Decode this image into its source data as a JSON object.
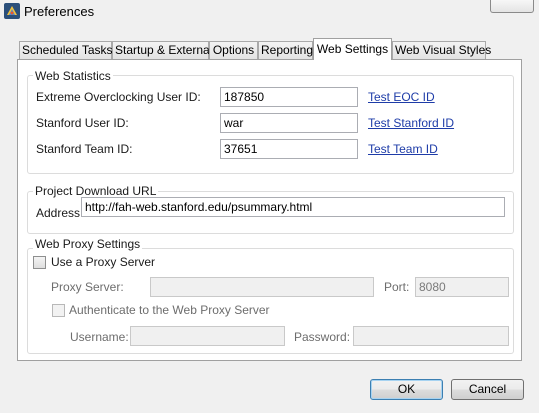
{
  "window": {
    "title": "Preferences"
  },
  "tabs": [
    {
      "label": "Scheduled Tasks",
      "active": false
    },
    {
      "label": "Startup & External",
      "active": false
    },
    {
      "label": "Options",
      "active": false
    },
    {
      "label": "Reporting",
      "active": false
    },
    {
      "label": "Web Settings",
      "active": true
    },
    {
      "label": "Web Visual Styles",
      "active": false
    }
  ],
  "web_statistics": {
    "legend": "Web Statistics",
    "eoc_user_id_label": "Extreme Overclocking User ID:",
    "eoc_user_id_value": "187850",
    "eoc_link": "Test EOC ID",
    "stanford_user_id_label": "Stanford User ID:",
    "stanford_user_id_value": "war",
    "stanford_link": "Test Stanford ID",
    "stanford_team_id_label": "Stanford Team ID:",
    "stanford_team_id_value": "37651",
    "team_link": "Test Team ID"
  },
  "project_download": {
    "legend": "Project Download URL",
    "address_label": "Address:",
    "address_value": "http://fah-web.stanford.edu/psummary.html"
  },
  "web_proxy": {
    "legend": "Web Proxy Settings",
    "use_proxy_label": "Use a Proxy Server",
    "use_proxy_checked": false,
    "proxy_server_label": "Proxy Server:",
    "proxy_server_value": "",
    "port_label": "Port:",
    "port_value": "8080",
    "authenticate_label": "Authenticate to the Web Proxy Server",
    "authenticate_checked": false,
    "username_label": "Username:",
    "username_value": "",
    "password_label": "Password:",
    "password_value": ""
  },
  "buttons": {
    "ok": "OK",
    "cancel": "Cancel"
  },
  "colors": {
    "link": "#1e3ca8",
    "default_button_border": "#3c7fb1"
  }
}
